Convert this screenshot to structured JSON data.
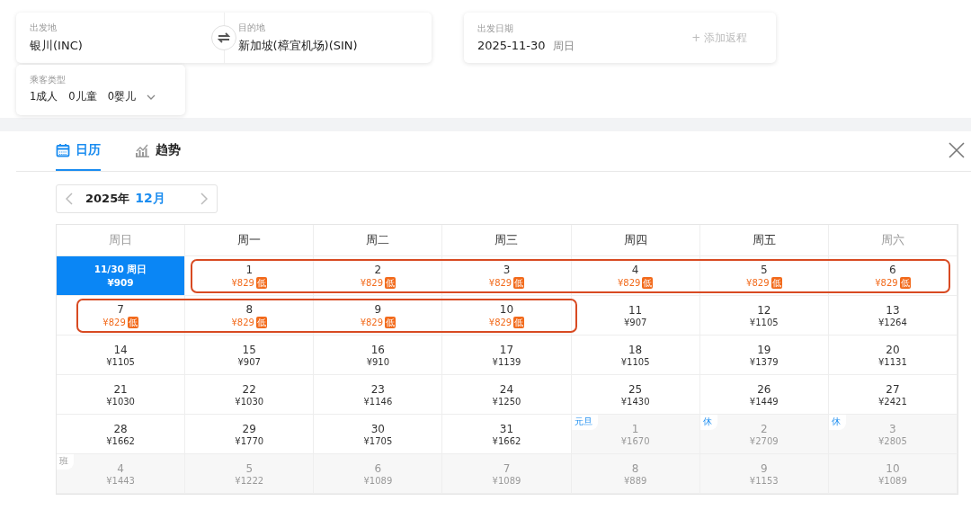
{
  "search": {
    "origin": {
      "label": "出发地",
      "value": "银川(INC)"
    },
    "destination": {
      "label": "目的地",
      "value": "新加坡(樟宜机场)(SIN)"
    },
    "date": {
      "label": "出发日期",
      "value": "2025-11-30",
      "weekday": "周日",
      "add_return": "+ 添加返程"
    },
    "passengers": {
      "label": "乘客类型",
      "values": [
        "1成人",
        "0儿童",
        "0婴儿"
      ]
    }
  },
  "tabs": [
    {
      "label": "日历",
      "selected": true
    },
    {
      "label": "趋势",
      "selected": false
    }
  ],
  "month_picker": {
    "year": "2025年",
    "month": "12月"
  },
  "weekdays": [
    {
      "label": "周日",
      "weekend": true
    },
    {
      "label": "周一",
      "weekend": false
    },
    {
      "label": "周二",
      "weekend": false
    },
    {
      "label": "周三",
      "weekend": false
    },
    {
      "label": "周四",
      "weekend": false
    },
    {
      "label": "周五",
      "weekend": false
    },
    {
      "label": "周六",
      "weekend": true
    }
  ],
  "weeks": [
    [
      {
        "day": "11/30 周日",
        "price": "¥909",
        "kind": "selected",
        "circled": false
      },
      {
        "day": "1",
        "price": "¥829",
        "kind": "low",
        "badge": "低",
        "circled": true
      },
      {
        "day": "2",
        "price": "¥829",
        "kind": "low",
        "badge": "低",
        "circled": true
      },
      {
        "day": "3",
        "price": "¥829",
        "kind": "low",
        "badge": "低",
        "circled": true
      },
      {
        "day": "4",
        "price": "¥829",
        "kind": "low",
        "badge": "低",
        "circled": true
      },
      {
        "day": "5",
        "price": "¥829",
        "kind": "low",
        "badge": "低",
        "circled": true
      },
      {
        "day": "6",
        "price": "¥829",
        "kind": "low",
        "badge": "低",
        "circled": true
      }
    ],
    [
      {
        "day": "7",
        "price": "¥829",
        "kind": "low",
        "badge": "低",
        "circled": true
      },
      {
        "day": "8",
        "price": "¥829",
        "kind": "low",
        "badge": "低",
        "circled": true
      },
      {
        "day": "9",
        "price": "¥829",
        "kind": "low",
        "badge": "低",
        "circled": true
      },
      {
        "day": "10",
        "price": "¥829",
        "kind": "low",
        "badge": "低",
        "circled": true
      },
      {
        "day": "11",
        "price": "¥907",
        "kind": "normal",
        "circled": false
      },
      {
        "day": "12",
        "price": "¥1105",
        "kind": "normal",
        "circled": false
      },
      {
        "day": "13",
        "price": "¥1264",
        "kind": "normal",
        "circled": false
      }
    ],
    [
      {
        "day": "14",
        "price": "¥1105",
        "kind": "normal",
        "circled": false
      },
      {
        "day": "15",
        "price": "¥907",
        "kind": "normal",
        "circled": false
      },
      {
        "day": "16",
        "price": "¥910",
        "kind": "normal",
        "circled": false
      },
      {
        "day": "17",
        "price": "¥1139",
        "kind": "normal",
        "circled": false
      },
      {
        "day": "18",
        "price": "¥1105",
        "kind": "normal",
        "circled": false
      },
      {
        "day": "19",
        "price": "¥1379",
        "kind": "normal",
        "circled": false
      },
      {
        "day": "20",
        "price": "¥1131",
        "kind": "normal",
        "circled": false
      }
    ],
    [
      {
        "day": "21",
        "price": "¥1030",
        "kind": "normal",
        "circled": false
      },
      {
        "day": "22",
        "price": "¥1030",
        "kind": "normal",
        "circled": false
      },
      {
        "day": "23",
        "price": "¥1146",
        "kind": "normal",
        "circled": false
      },
      {
        "day": "24",
        "price": "¥1250",
        "kind": "normal",
        "circled": false
      },
      {
        "day": "25",
        "price": "¥1430",
        "kind": "normal",
        "circled": false
      },
      {
        "day": "26",
        "price": "¥1449",
        "kind": "normal",
        "circled": false
      },
      {
        "day": "27",
        "price": "¥2421",
        "kind": "normal",
        "circled": false
      }
    ],
    [
      {
        "day": "28",
        "price": "¥1662",
        "kind": "normal",
        "circled": false
      },
      {
        "day": "29",
        "price": "¥1770",
        "kind": "normal",
        "circled": false
      },
      {
        "day": "30",
        "price": "¥1705",
        "kind": "normal",
        "circled": false
      },
      {
        "day": "31",
        "price": "¥1662",
        "kind": "normal",
        "circled": false
      },
      {
        "day": "1",
        "price": "¥1670",
        "kind": "other",
        "tag": {
          "text": "元旦",
          "kind": "holiday"
        },
        "circled": false
      },
      {
        "day": "2",
        "price": "¥2709",
        "kind": "other",
        "tag": {
          "text": "休",
          "kind": "holiday"
        },
        "circled": false
      },
      {
        "day": "3",
        "price": "¥2805",
        "kind": "other",
        "tag": {
          "text": "休",
          "kind": "holiday"
        },
        "circled": false
      }
    ],
    [
      {
        "day": "4",
        "price": "¥1443",
        "kind": "other",
        "tag": {
          "text": "班",
          "kind": "workday"
        },
        "circled": false
      },
      {
        "day": "5",
        "price": "¥1222",
        "kind": "other",
        "circled": false
      },
      {
        "day": "6",
        "price": "¥1089",
        "kind": "other",
        "circled": false
      },
      {
        "day": "7",
        "price": "¥1089",
        "kind": "other",
        "circled": false
      },
      {
        "day": "8",
        "price": "¥889",
        "kind": "other",
        "circled": false
      },
      {
        "day": "9",
        "price": "¥1153",
        "kind": "other",
        "circled": false
      },
      {
        "day": "10",
        "price": "¥1089",
        "kind": "other",
        "circled": false
      }
    ]
  ]
}
